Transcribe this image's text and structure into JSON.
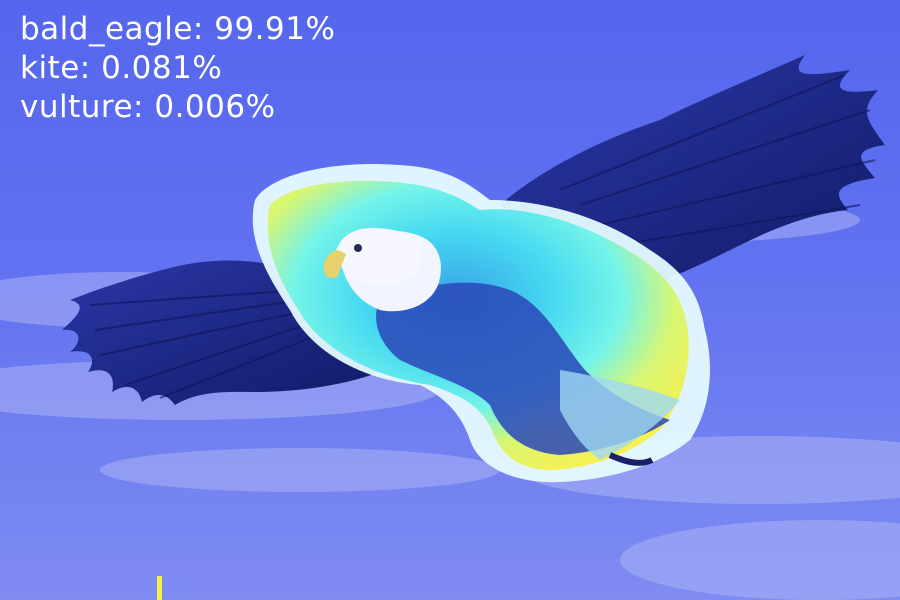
{
  "predictions": [
    {
      "label": "bald_eagle",
      "score": "99.91%"
    },
    {
      "label": "kite",
      "score": "0.081%"
    },
    {
      "label": "vulture",
      "score": "0.006%"
    }
  ],
  "separator": ": ",
  "colors": {
    "sky": "#5d6cf0",
    "sky_light": "#aab2f6",
    "wing": "#1f2a8a",
    "wing_dark": "#141c6a",
    "heat_cyan": "#3ff0f0",
    "heat_yellow": "#f4f24a",
    "heat_white": "#eefcff",
    "text": "#ffffff"
  },
  "image_subject": "bald-eagle"
}
